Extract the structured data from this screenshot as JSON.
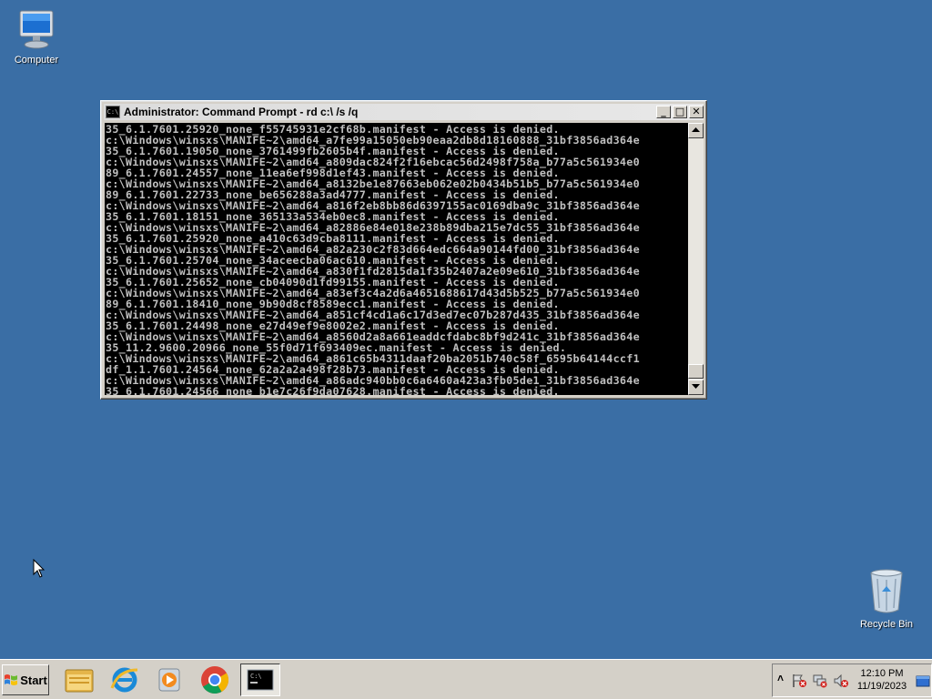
{
  "desktop": {
    "background_color": "#3a6ea5",
    "icons": [
      {
        "label": "Computer",
        "icon": "computer-icon"
      },
      {
        "label": "Recycle Bin",
        "icon": "recycle-bin-icon"
      }
    ]
  },
  "window": {
    "title": "Administrator: Command Prompt - rd  c:\\ /s /q",
    "buttons": {
      "minimize": "_",
      "maximize": "□",
      "close": "✕"
    },
    "console_lines": [
      "35_6.1.7601.25920_none_f55745931e2cf68b.manifest - Access is denied.",
      "c:\\Windows\\winsxs\\MANIFE~2\\amd64_a7fe99a15050eb90eaa2db8d18160888_31bf3856ad364e",
      "35_6.1.7601.19050_none_3761499fb2605b4f.manifest - Access is denied.",
      "c:\\Windows\\winsxs\\MANIFE~2\\amd64_a809dac824f2f16ebcac56d2498f758a_b77a5c561934e0",
      "89_6.1.7601.24557_none_11ea6ef998d1ef43.manifest - Access is denied.",
      "c:\\Windows\\winsxs\\MANIFE~2\\amd64_a8132be1e87663eb062e02b0434b51b5_b77a5c561934e0",
      "89_6.1.7601.22733_none_be656288a3ad4777.manifest - Access is denied.",
      "c:\\Windows\\winsxs\\MANIFE~2\\amd64_a816f2eb8bb86d6397155ac0169dba9c_31bf3856ad364e",
      "35_6.1.7601.18151_none_365133a534eb0ec8.manifest - Access is denied.",
      "c:\\Windows\\winsxs\\MANIFE~2\\amd64_a82886e84e018e238b89dba215e7dc55_31bf3856ad364e",
      "35_6.1.7601.25920_none_a410c63d9cba8111.manifest - Access is denied.",
      "c:\\Windows\\winsxs\\MANIFE~2\\amd64_a82a230c2f83d664edc664a90144fd00_31bf3856ad364e",
      "35_6.1.7601.25704_none_34aceecba06ac610.manifest - Access is denied.",
      "c:\\Windows\\winsxs\\MANIFE~2\\amd64_a830f1fd2815da1f35b2407a2e09e610_31bf3856ad364e",
      "35_6.1.7601.25652_none_cb04090d1fd99155.manifest - Access is denied.",
      "c:\\Windows\\winsxs\\MANIFE~2\\amd64_a83ef3c4a2d6a4651688617d43d5b525_b77a5c561934e0",
      "89_6.1.7601.18410_none_9b90d8cf8589ecc1.manifest - Access is denied.",
      "c:\\Windows\\winsxs\\MANIFE~2\\amd64_a851cf4cd1a6c17d3ed7ec07b287d435_31bf3856ad364e",
      "35_6.1.7601.24498_none_e27d49ef9e8002e2.manifest - Access is denied.",
      "c:\\Windows\\winsxs\\MANIFE~2\\amd64_a8560d2a8a661eaddcfdabc8bf9d241c_31bf3856ad364e",
      "35_11.2.9600.20966_none_55f0d71f693409ec.manifest - Access is denied.",
      "c:\\Windows\\winsxs\\MANIFE~2\\amd64_a861c65b4311daaf20ba2051b740c58f_6595b64144ccf1",
      "df_1.1.7601.24564_none_62a2a2a498f28b73.manifest - Access is denied.",
      "c:\\Windows\\winsxs\\MANIFE~2\\amd64_a86adc940bb0c6a6460a423a3fb05de1_31bf3856ad364e",
      "35_6.1.7601.24566_none_b1e7c26f9da07628.manifest - Access is denied."
    ]
  },
  "taskbar": {
    "start_label": "Start",
    "pinned": [
      {
        "name": "file-explorer",
        "icon": "folder-icon"
      },
      {
        "name": "internet-explorer",
        "icon": "internet-explorer-icon"
      },
      {
        "name": "media-player",
        "icon": "media-player-icon"
      },
      {
        "name": "chrome",
        "icon": "chrome-icon"
      },
      {
        "name": "command-prompt",
        "icon": "command-prompt-icon",
        "active": true
      }
    ],
    "tray": {
      "show_hidden": "˄",
      "time": "12:10 PM",
      "date": "11/19/2023"
    }
  }
}
